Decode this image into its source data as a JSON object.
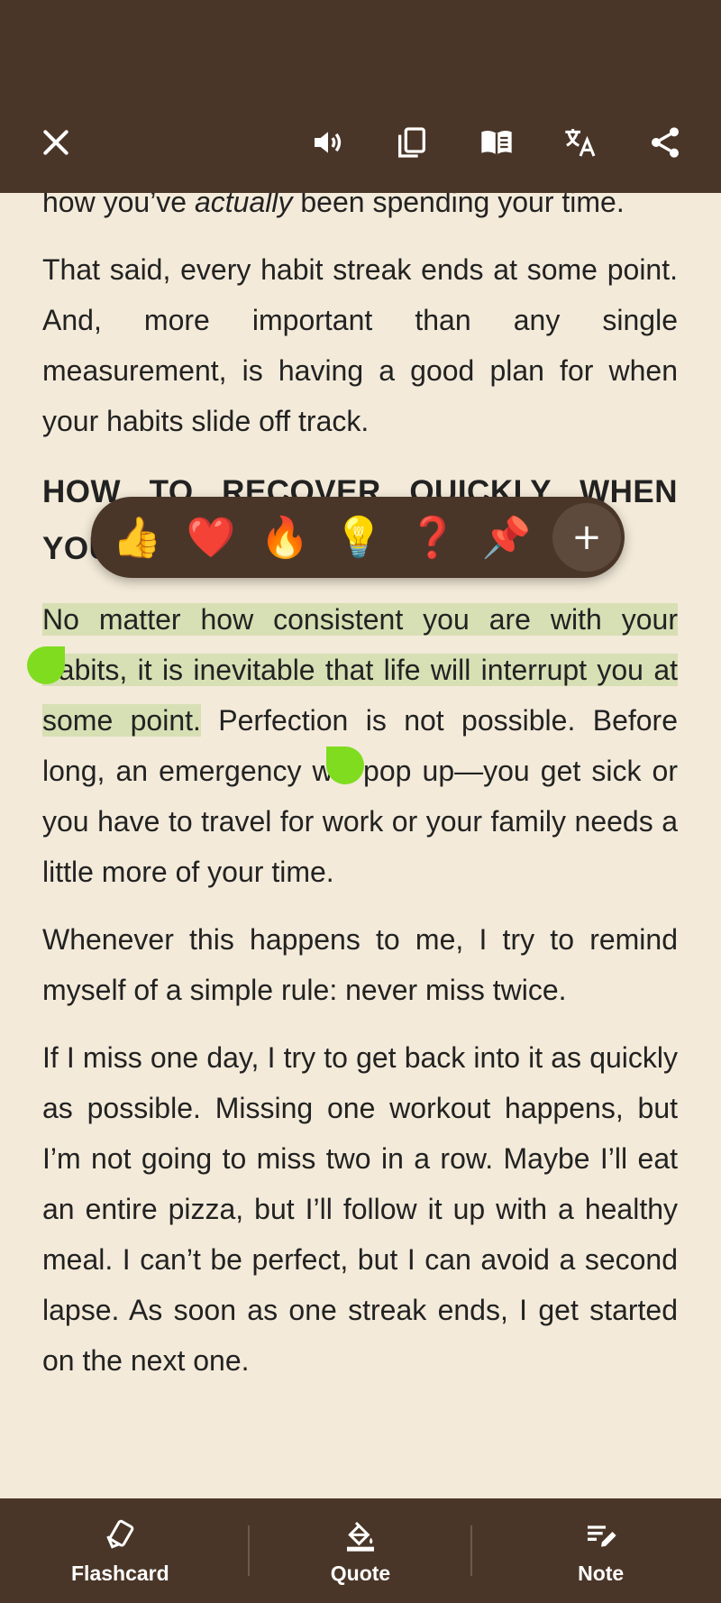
{
  "toolbar": {
    "close_icon": "close-icon",
    "icons": [
      "speaker-icon",
      "copy-icon",
      "book-icon",
      "translate-icon",
      "share-icon"
    ]
  },
  "content": {
    "p0_pre": "how you’ve ",
    "p0_em": "actually",
    "p0_post": " been spending your time.",
    "p1": "That said, every habit streak ends at some point. And, more important than any single measurement, is having a good plan for when your habits slide off track.",
    "heading": "HOW TO RECOVER QUICKLY WHEN YOUR HABITS BREAK DOWN",
    "p2_highlight": "No matter how consistent you are with your habits, it is inevitable that life will interrupt you at some point.",
    "p2_rest": " Perfection is not possible. Before long, an emergency will pop up—you get sick or you have to travel for work or your family needs a little more of your time.",
    "p3": "Whenever this happens to me, I try to remind myself of a simple rule: never miss twice.",
    "p4": "If I miss one day, I try to get back into it as quickly as possible. Missing one workout happens, but I’m not going to miss two in a row. Maybe I’ll eat an entire pizza, but I’ll follow it up with a healthy meal. I can’t be perfect, but I can avoid a second lapse. As soon as one streak ends, I get started on the next one."
  },
  "reactions": {
    "thumbs": "👍",
    "heart": "❤️",
    "fire": "🔥",
    "bulb": "💡",
    "question": "❓",
    "pin": "📌",
    "plus": "+"
  },
  "bottom": {
    "flashcard": "Flashcard",
    "quote": "Quote",
    "note": "Note"
  },
  "colors": {
    "bar": "#4a3628",
    "page": "#f3ead9",
    "highlight": "#d7dfb4",
    "handle": "#7fdc1f"
  }
}
